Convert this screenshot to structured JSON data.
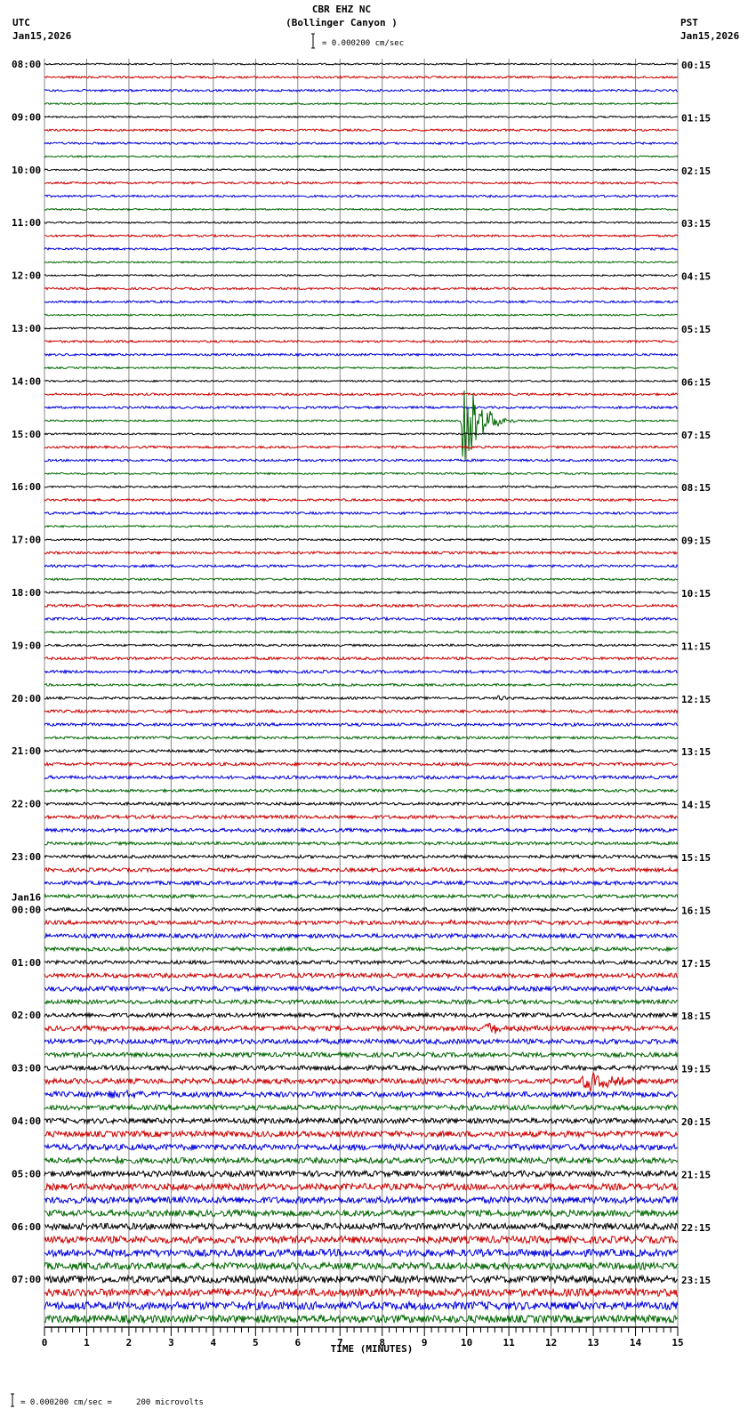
{
  "header": {
    "station": "CBR EHZ NC",
    "location": "(Bollinger Canyon )",
    "scale": "= 0.000200 cm/sec",
    "left_tz": "UTC",
    "left_date": "Jan15,2026",
    "right_tz": "PST",
    "right_date": "Jan15,2026"
  },
  "footer": {
    "scale_note": "= 0.000200 cm/sec =     200 microvolts"
  },
  "chart_data": {
    "type": "line",
    "title": "CBR EHZ NC (Bollinger Canyon )",
    "xlabel": "TIME (MINUTES)",
    "xlim": [
      0,
      15
    ],
    "x_ticks": [
      "0",
      "1",
      "2",
      "3",
      "4",
      "5",
      "6",
      "7",
      "8",
      "9",
      "10",
      "11",
      "12",
      "13",
      "14",
      "15"
    ],
    "grid": true,
    "traces_per_hour": 4,
    "trace_count": 96,
    "trace_colors": [
      "#000000",
      "#cc0000",
      "#0000dd",
      "#006600"
    ],
    "left_labels": [
      "08:00",
      "09:00",
      "10:00",
      "11:00",
      "12:00",
      "13:00",
      "14:00",
      "15:00",
      "16:00",
      "17:00",
      "18:00",
      "19:00",
      "20:00",
      "21:00",
      "22:00",
      "23:00",
      "00:00",
      "01:00",
      "02:00",
      "03:00",
      "04:00",
      "05:00",
      "06:00",
      "07:00"
    ],
    "left_date_change": {
      "label": "Jan16",
      "before_hour_index": 16
    },
    "right_labels": [
      "00:15",
      "01:15",
      "02:15",
      "03:15",
      "04:15",
      "05:15",
      "06:15",
      "07:15",
      "08:15",
      "09:15",
      "10:15",
      "11:15",
      "12:15",
      "13:15",
      "14:15",
      "15:15",
      "16:15",
      "17:15",
      "18:15",
      "19:15",
      "20:15",
      "21:15",
      "22:15",
      "23:15"
    ],
    "events": [
      {
        "trace": 27,
        "start_min": 9.85,
        "duration_min": 1.3,
        "amplitude": 90
      },
      {
        "trace": 48,
        "start_min": 10.7,
        "duration_min": 0.7,
        "amplitude": 5
      },
      {
        "trace": 65,
        "start_min": 9.3,
        "duration_min": 1.4,
        "amplitude": 3
      },
      {
        "trace": 73,
        "start_min": 10.4,
        "duration_min": 1.6,
        "amplitude": 10
      },
      {
        "trace": 77,
        "start_min": 12.7,
        "duration_min": 2.3,
        "amplitude": 14
      },
      {
        "trace": 78,
        "start_min": 1.3,
        "duration_min": 2.5,
        "amplitude": 5
      },
      {
        "trace": 2,
        "start_min": 11.6,
        "duration_min": 0.2,
        "amplitude": 4
      },
      {
        "trace": 83,
        "start_min": 1.7,
        "duration_min": 0.2,
        "amplitude": 6
      }
    ]
  }
}
